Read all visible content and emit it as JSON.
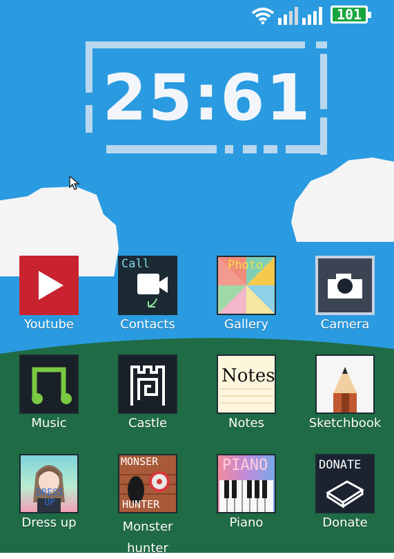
{
  "status_bar": {
    "wifi_icon": "wifi-icon",
    "signal_icons": [
      "signal-bars-icon",
      "signal-bars-icon"
    ],
    "battery_level": "101"
  },
  "clock": {
    "time": "25:61"
  },
  "apps": [
    {
      "label": "Youtube",
      "icon": "play-icon"
    },
    {
      "label": "Contacts",
      "icon": "video-call-icon",
      "tile_text": "Call"
    },
    {
      "label": "Gallery",
      "icon": "photo-pinwheel-icon",
      "tile_text": "Photo"
    },
    {
      "label": "Camera",
      "icon": "camera-icon"
    },
    {
      "label": "Music",
      "icon": "music-note-icon"
    },
    {
      "label": "Castle",
      "icon": "castle-icon"
    },
    {
      "label": "Notes",
      "icon": "notes-icon",
      "tile_text": "Notes"
    },
    {
      "label": "Sketchbook",
      "icon": "pencil-icon"
    },
    {
      "label": "Dress up",
      "icon": "dress-up-icon",
      "tile_text": "DRESS UP"
    },
    {
      "label": "Monster hunter",
      "icon": "monster-hunter-icon",
      "tile_text_top": "MONSER",
      "tile_text_bottom": "HUNTER"
    },
    {
      "label": "Piano",
      "icon": "piano-icon",
      "tile_text": "PIANO"
    },
    {
      "label": "Donate",
      "icon": "donate-icon",
      "tile_text": "DONATE"
    }
  ],
  "colors": {
    "sky": "#2a9be0",
    "hill": "#1f6b45",
    "battery": "#18a53f",
    "youtube": "#c8232f"
  }
}
